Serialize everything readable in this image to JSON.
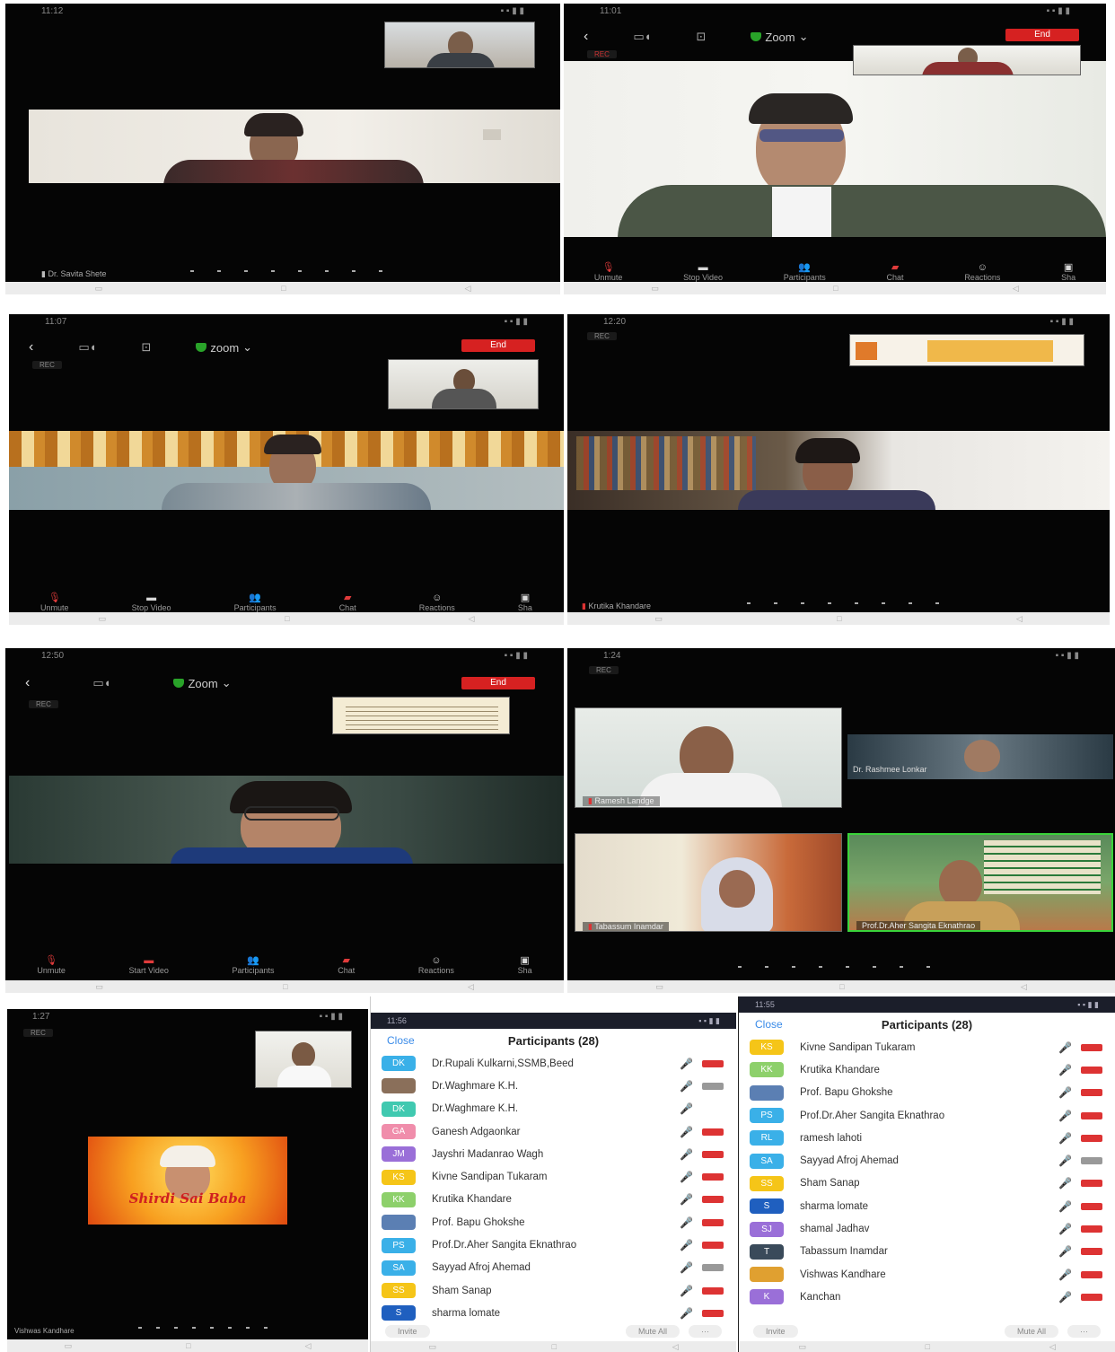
{
  "shots": {
    "s1": {
      "time": "11:12",
      "speaker": "Dr. Savita Shete"
    },
    "s2": {
      "time": "11:01",
      "app": "Zoom",
      "end": "End",
      "rec": "REC"
    },
    "s3": {
      "time": "11:07",
      "app": "zoom",
      "end": "End",
      "rec": "REC"
    },
    "s4": {
      "time": "12:20",
      "rec": "REC",
      "speaker": "Krutika Khandare"
    },
    "s5": {
      "time": "12:50",
      "app": "Zoom",
      "end": "End",
      "rec": "REC"
    },
    "s6": {
      "time": "1:24",
      "rec": "REC",
      "tiles": [
        "Ramesh Landge",
        "Dr. Rashmee Lonkar",
        "Tabassum Inamdar",
        "Prof.Dr.Aher Sangita Eknathrao"
      ]
    },
    "s7": {
      "time": "1:27",
      "rec": "REC",
      "speaker": "Vishwas Kandhare",
      "shared_text_1": "Shirdi",
      "shared_text_2": "Sai Baba"
    }
  },
  "toolbar": {
    "unmute": "Unmute",
    "stop_video": "Stop Video",
    "start_video": "Start Video",
    "participants": "Participants",
    "chat": "Chat",
    "reactions": "Reactions",
    "share": "Sha"
  },
  "participants_a": {
    "time": "11:56",
    "close": "Close",
    "title": "Participants (28)",
    "invite": "Invite",
    "mute_all": "Mute All",
    "more": "···",
    "rows": [
      {
        "initials": "DK",
        "color": "#3ab0e8",
        "name": "Dr.Rupali Kulkarni,SSMB,Beed",
        "cam": "red"
      },
      {
        "initials": "",
        "color": "#8a6f5a",
        "name": "Dr.Waghmare K.H.",
        "cam": "grey"
      },
      {
        "initials": "DK",
        "color": "#40c9b0",
        "name": "Dr.Waghmare K.H.",
        "cam": "none"
      },
      {
        "initials": "GA",
        "color": "#f08dab",
        "name": "Ganesh Adgaonkar",
        "cam": "red"
      },
      {
        "initials": "JM",
        "color": "#9a6fd8",
        "name": "Jayshri Madanrao Wagh",
        "cam": "red"
      },
      {
        "initials": "KS",
        "color": "#f5c518",
        "name": "Kivne Sandipan Tukaram",
        "cam": "red"
      },
      {
        "initials": "KK",
        "color": "#8dd06b",
        "name": "Krutika Khandare",
        "cam": "red"
      },
      {
        "initials": "",
        "color": "#5b7fb3",
        "name": "Prof. Bapu Ghokshe",
        "cam": "red"
      },
      {
        "initials": "PS",
        "color": "#3ab0e8",
        "name": "Prof.Dr.Aher Sangita Eknathrao",
        "cam": "red"
      },
      {
        "initials": "SA",
        "color": "#3ab0e8",
        "name": "Sayyad Afroj Ahemad",
        "cam": "grey"
      },
      {
        "initials": "SS",
        "color": "#f5c518",
        "name": "Sham Sanap",
        "cam": "red"
      },
      {
        "initials": "S",
        "color": "#1f5fbf",
        "name": "sharma lomate",
        "cam": "red"
      }
    ]
  },
  "participants_b": {
    "time": "11:55",
    "close": "Close",
    "title": "Participants (28)",
    "invite": "Invite",
    "mute_all": "Mute All",
    "more": "···",
    "rows": [
      {
        "initials": "KS",
        "color": "#f5c518",
        "name": "Kivne Sandipan Tukaram",
        "cam": "red"
      },
      {
        "initials": "KK",
        "color": "#8dd06b",
        "name": "Krutika Khandare",
        "cam": "red"
      },
      {
        "initials": "",
        "color": "#5b7fb3",
        "name": "Prof. Bapu Ghokshe",
        "cam": "red"
      },
      {
        "initials": "PS",
        "color": "#3ab0e8",
        "name": "Prof.Dr.Aher Sangita Eknathrao",
        "cam": "red"
      },
      {
        "initials": "RL",
        "color": "#3ab0e8",
        "name": "ramesh lahoti",
        "cam": "red"
      },
      {
        "initials": "SA",
        "color": "#3ab0e8",
        "name": "Sayyad Afroj Ahemad",
        "cam": "grey"
      },
      {
        "initials": "SS",
        "color": "#f5c518",
        "name": "Sham Sanap",
        "cam": "red"
      },
      {
        "initials": "S",
        "color": "#1f5fbf",
        "name": "sharma lomate",
        "cam": "red"
      },
      {
        "initials": "SJ",
        "color": "#9a6fd8",
        "name": "shamal Jadhav",
        "cam": "red"
      },
      {
        "initials": "T",
        "color": "#3a4a5a",
        "name": "Tabassum Inamdar",
        "cam": "red"
      },
      {
        "initials": "",
        "color": "#e0a030",
        "name": "Vishwas Kandhare",
        "cam": "red"
      },
      {
        "initials": "K",
        "color": "#9a6fd8",
        "name": "Kanchan",
        "cam": "red"
      }
    ]
  }
}
